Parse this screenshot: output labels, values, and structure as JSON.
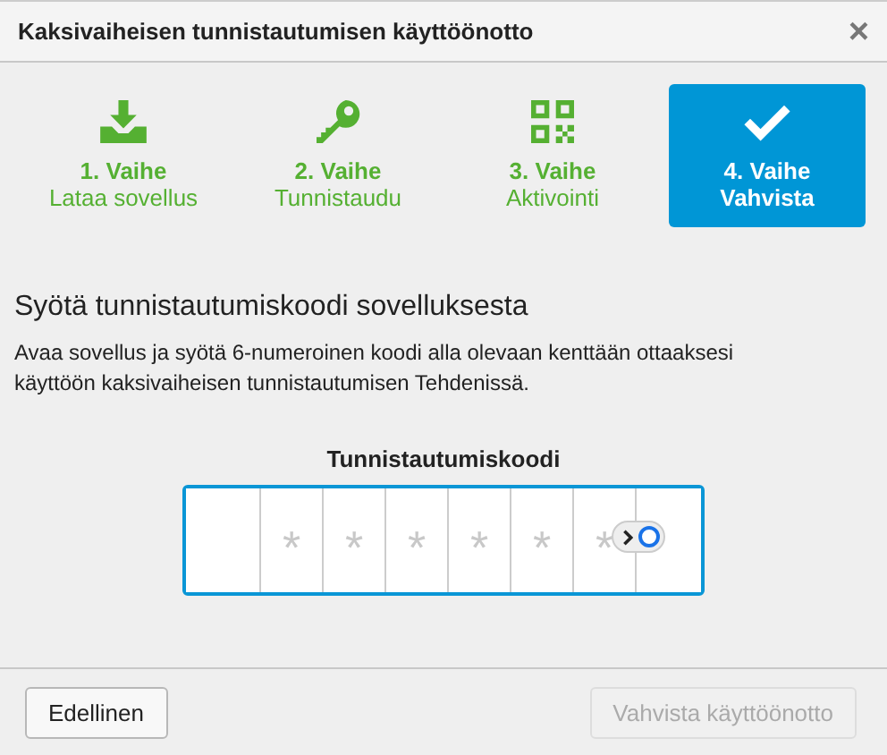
{
  "window": {
    "title": "Kaksivaiheisen tunnistautumisen käyttöönotto",
    "close": "×"
  },
  "steps": [
    {
      "kind": "download",
      "step": "1. Vaihe",
      "label": "Lataa sovellus",
      "selected": false
    },
    {
      "kind": "key",
      "step": "2. Vaihe",
      "label": "Tunnistaudu",
      "selected": false
    },
    {
      "kind": "qr",
      "step": "3. Vaihe",
      "label": "Aktivointi",
      "selected": false
    },
    {
      "kind": "check",
      "step": "4. Vaihe",
      "label": "Vahvista",
      "selected": true
    }
  ],
  "heading": "Syötä tunnistautumiskoodi sovelluksesta",
  "description": "Avaa sovellus ja syötä 6-numeroinen koodi alla olevaan kenttään ottaaksesi käyttöön kaksivaiheisen tunnistautumisen Tehdenissä.",
  "code_field": {
    "label": "Tunnistautumiskoodi",
    "cells": [
      {},
      {
        "placeholder": "*"
      },
      {
        "placeholder": "*"
      },
      {
        "placeholder": "*"
      },
      {
        "placeholder": "*"
      },
      {
        "placeholder": "*"
      },
      {
        "placeholder": "*"
      },
      {}
    ]
  },
  "buttons": [
    {
      "label": "Edellinen",
      "disabled": false
    },
    {
      "label": "Vahvista käyttöönotto",
      "disabled": true
    }
  ]
}
